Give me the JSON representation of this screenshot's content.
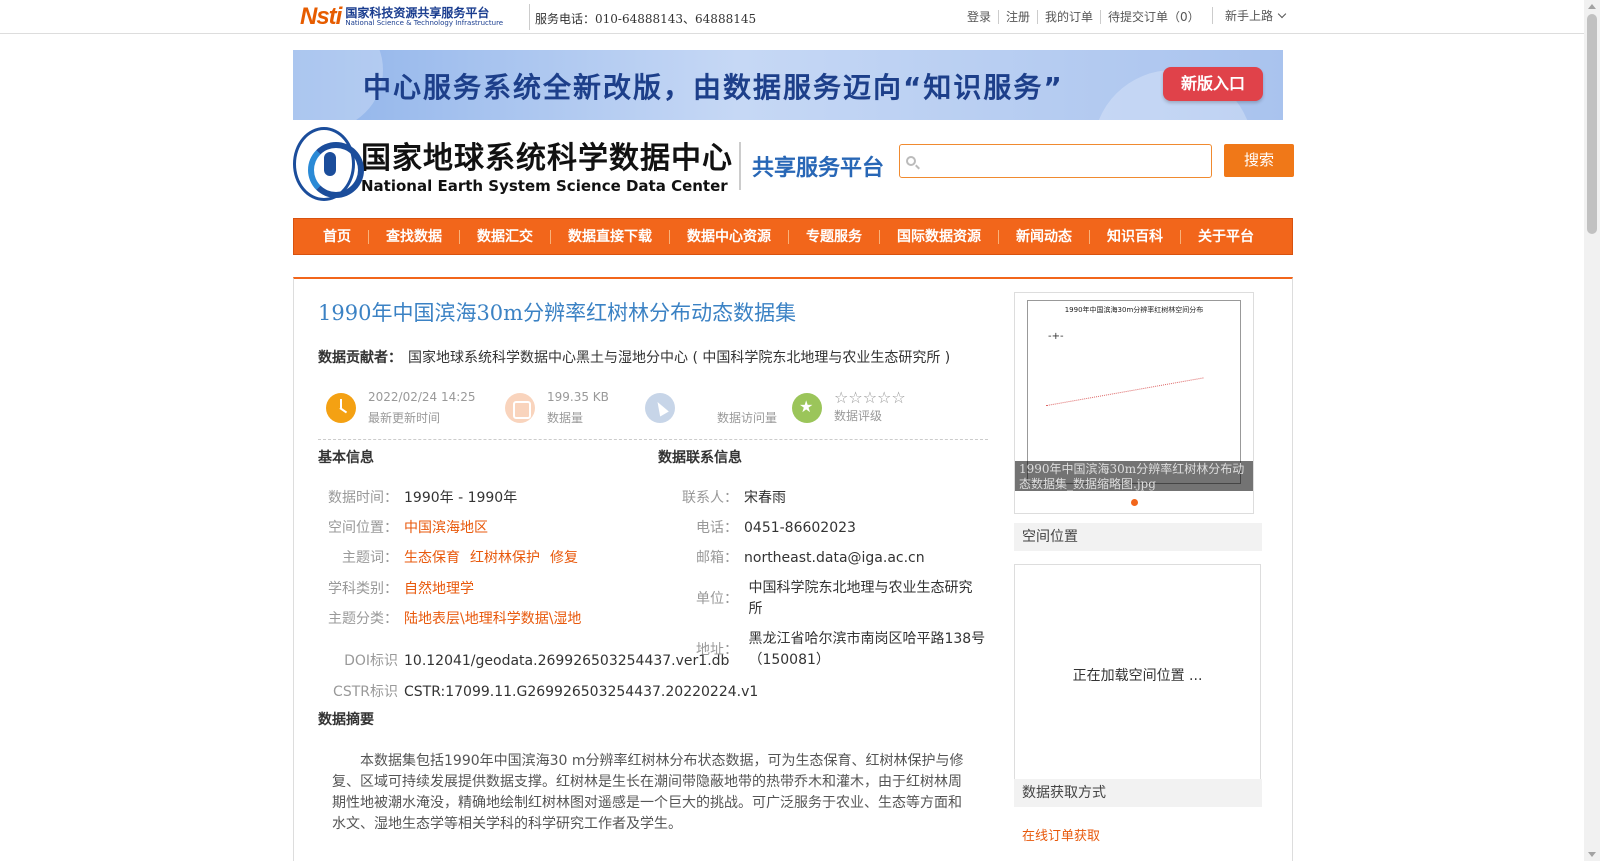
{
  "topbar": {
    "logo_mark": "Nsti",
    "logo_cn": "国家科技资源共享服务平台",
    "logo_en": "National Science & Technology Infrastructure",
    "hotline": "服务电话：010-64888143、64888145",
    "links": [
      "登录",
      "注册",
      "我的订单",
      "待提交订单（0）"
    ],
    "guide": "新手上路"
  },
  "banner": {
    "text": "中心服务系统全新改版，由数据服务迈向“知识服务”",
    "button": "新版入口"
  },
  "header": {
    "center_cn": "国家地球系统科学数据中心",
    "center_en": "National Earth System Science Data Center",
    "platform": "共享服务平台",
    "search_placeholder": "",
    "search_button": "搜索"
  },
  "nav": [
    "首页",
    "查找数据",
    "数据汇交",
    "数据直接下载",
    "数据中心资源",
    "专题服务",
    "国际数据资源",
    "新闻动态",
    "知识百科",
    "关于平台"
  ],
  "dataset": {
    "title": "1990年中国滨海30m分辨率红树林分布动态数据集",
    "contributor_label": "数据贡献者：",
    "contributor": "国家地球系统科学数据中心黑土与湿地分中心 ( 中国科学院东北地理与农业生态研究所 )",
    "stats": {
      "updated": "2022/02/24 14:25",
      "updated_label": "最新更新时间",
      "size": "199.35 KB",
      "size_label": "数据量",
      "visits": "",
      "visits_label": "数据访问量",
      "rating_stars": "☆☆☆☆☆",
      "rating_value": 0,
      "rating_label": "数据评级"
    },
    "basic": {
      "heading": "基本信息",
      "time_label": "数据时间：",
      "time": "1990年 - 1990年",
      "location_label": "空间位置：",
      "location": "中国滨海地区",
      "keywords_label": "主题词：",
      "keywords": [
        "生态保育",
        "红树林保护",
        "修复"
      ],
      "discipline_label": "学科类别：",
      "discipline": "自然地理学",
      "category_label": "主题分类：",
      "category": "陆地表层\\地理科学数据\\湿地",
      "doi_label": "DOI标识",
      "doi": "10.12041/geodata.269926503254437.ver1.db",
      "cstr_label": "CSTR标识",
      "cstr": "CSTR:17099.11.G269926503254437.20220224.v1"
    },
    "contact": {
      "heading": "数据联系信息",
      "person_label": "联系人：",
      "person": "宋春雨",
      "phone_label": "电话：",
      "phone": "0451-86602023",
      "email_label": "邮箱：",
      "email": "northeast.data@iga.ac.cn",
      "org_label": "单位：",
      "org_line1": "中国科学院东北地理与农业生态研究",
      "org_line2": "所",
      "addr_label": "地址：",
      "addr_line1": "黑龙江省哈尔滨市南岗区哈平路138号",
      "addr_line2": "（150081）"
    },
    "abstract_heading": "数据摘要",
    "abstract": "本数据集包括1990年中国滨海30 m分辨率红树林分布状态数据，可为生态保育、红树林保护与修复、区域可持续发展提供数据支撑。红树林是生长在潮间带隐蔽地带的热带乔木和灌木，由于红树林周期性地被潮水淹没，精确地绘制红树林图对遥感是一个巨大的挑战。可广泛服务于农业、生态等方面和水文、湿地生态学等相关学科的科学研究工作者及学生。"
  },
  "sidebar": {
    "thumb_title": "1990年中国滨海30m分辨率红树林空间分布",
    "thumb_caption": "1990年中国滨海30m分辨率红树林分布动态数据集_数据缩略图.jpg",
    "spatial_heading": "空间位置",
    "spatial_loading": "正在加载空间位置 ...",
    "access_heading": "数据获取方式",
    "access_link": "在线订单获取"
  },
  "colors": {
    "accent": "#f2661b",
    "title_blue": "#3b82c4",
    "link_orange": "#e8590c"
  }
}
